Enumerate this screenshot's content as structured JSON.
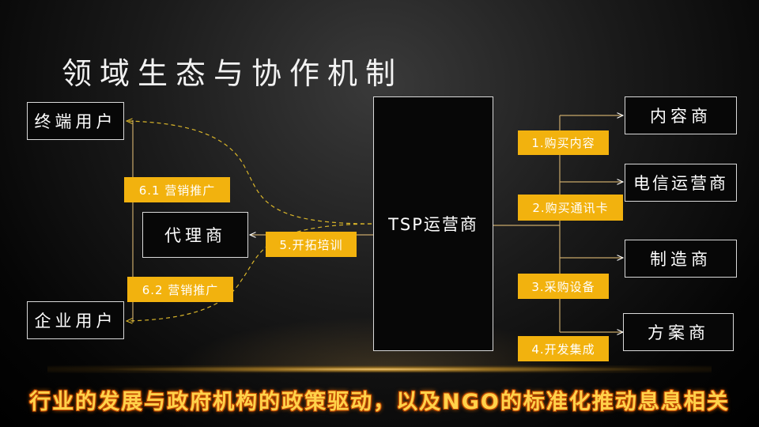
{
  "title": "领域生态与协作机制",
  "nodes": {
    "end_user": "终端用户",
    "agent": "代理商",
    "enterprise_user": "企业用户",
    "tsp": "TSP运营商",
    "content_provider": "内容商",
    "telecom_operator": "电信运营商",
    "manufacturer": "制造商",
    "solution_provider": "方案商"
  },
  "labels": {
    "buy_content": "1.购买内容",
    "buy_sim": "2.购买通讯卡",
    "procure_equipment": "3.采购设备",
    "develop_integrate": "4.开发集成",
    "expand_training": "5.开拓培训",
    "marketing_1": "6.1 营销推广",
    "marketing_2": "6.2 营销推广"
  },
  "footer": "行业的发展与政府机构的政策驱动，以及NGO的标准化推动息息相关",
  "colors": {
    "accent": "#f2b20e",
    "line": "#c8a86a",
    "dashed": "#d9b52a",
    "footer_text": "#ffd24a"
  }
}
